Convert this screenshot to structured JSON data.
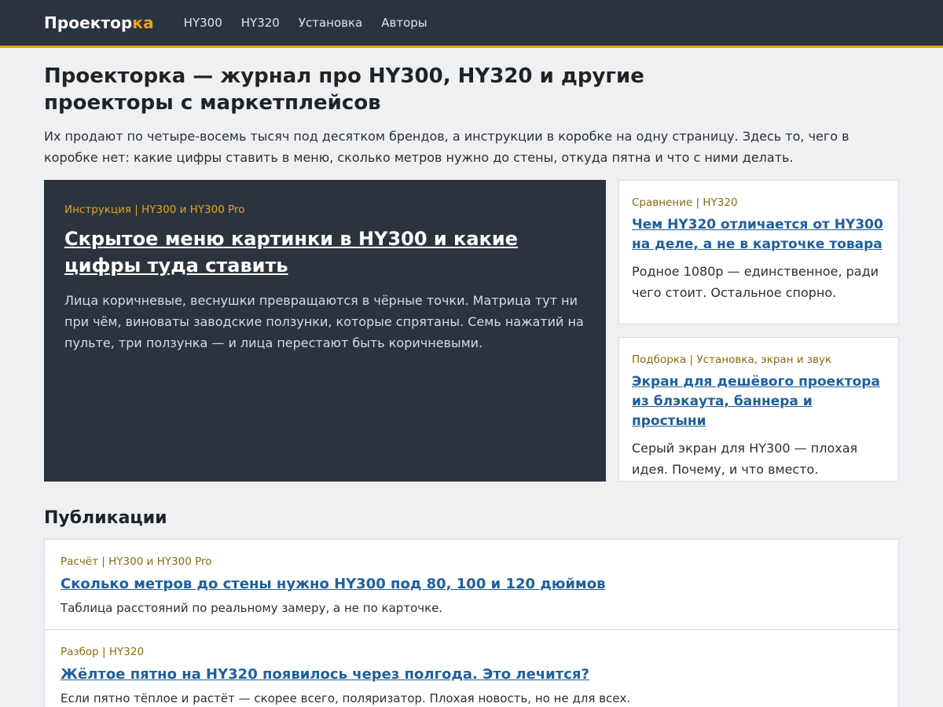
{
  "header": {
    "logo_main": "Проектор",
    "logo_accent": "ка",
    "nav": [
      "HY300",
      "HY320",
      "Установка",
      "Авторы"
    ],
    "accent_color": "#e8a21a",
    "bg_color": "#2b343e"
  },
  "page": {
    "title": "Проекторка — журнал про HY300, HY320 и другие проекторы с маркетплейсов",
    "intro": "Их продают по четыре-восемь тысяч под десятком брендов, а инструкции в коробке на одну страницу. Здесь то, чего в коробке нет: какие цифры ставить в меню, сколько метров нужно до стены, откуда пятна и что с ними делать."
  },
  "featured": {
    "meta": "Инструкция | HY300 и HY300 Pro",
    "title": "Скрытое меню картинки в HY300 и какие цифры туда ставить",
    "desc": "Лица коричневые, веснушки превращаются в чёрные точки. Матрица тут ни при чём, виноваты заводские ползунки, которые спрятаны. Семь нажатий на пульте, три ползунка — и лица перестают быть коричневыми."
  },
  "side_cards": [
    {
      "meta": "Сравнение | HY320",
      "title": "Чем HY320 отличается от HY300 на деле, а не в карточке товара",
      "desc": "Родное 1080p — единственное, ради чего стоит. Остальное спорно."
    },
    {
      "meta": "Подборка | Установка, экран и звук",
      "title": "Экран для дешёвого проектора из блэкаута, баннера и простыни",
      "desc": "Серый экран для HY300 — плохая идея. Почему, и что вместо."
    }
  ],
  "publications": {
    "heading": "Публикации",
    "items": [
      {
        "meta": "Расчёт | HY300 и HY300 Pro",
        "title": "Сколько метров до стены нужно HY300 под 80, 100 и 120 дюймов",
        "desc": "Таблица расстояний по реальному замеру, а не по карточке."
      },
      {
        "meta": "Разбор | HY320",
        "title": "Жёлтое пятно на HY320 появилось через полгода. Это лечится?",
        "desc": "Если пятно тёплое и растёт — скорее всего, поляризатор. Плохая новость, но не для всех."
      }
    ]
  }
}
